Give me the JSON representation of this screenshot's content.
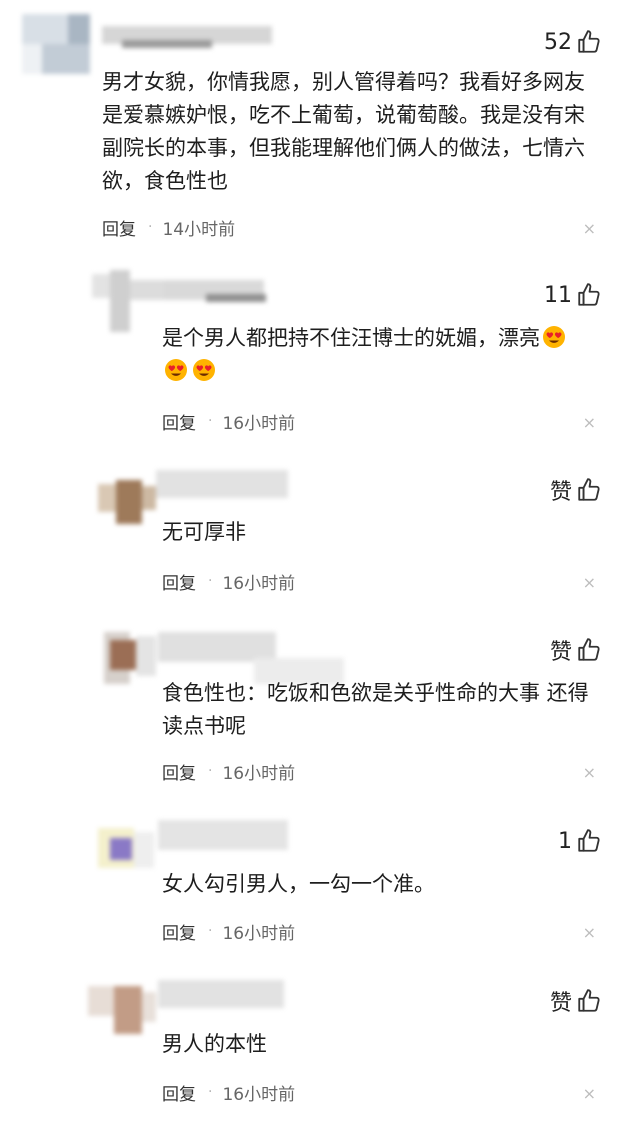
{
  "comments": [
    {
      "likes": "52",
      "text": "男才女貌，你情我愿，别人管得着吗？我看好多网友是爱慕嫉妒恨，吃不上葡萄，说葡萄酸。我是没有宋副院长的本事，但我能理解他们俩人的做法，七情六欲，食色性也",
      "reply_label": "回复",
      "dot": "·",
      "time": "14小时前",
      "close": "×"
    },
    {
      "likes": "11",
      "text": "是个男人都把持不住汪博士的妩媚，漂亮",
      "emojis": [
        "heart-eyes-emoji",
        "heart-eyes-emoji",
        "heart-eyes-emoji"
      ],
      "reply_label": "回复",
      "dot": "·",
      "time": "16小时前",
      "close": "×"
    },
    {
      "likes": "赞",
      "text": "无可厚非",
      "reply_label": "回复",
      "dot": "·",
      "time": "16小时前",
      "close": "×"
    },
    {
      "likes": "赞",
      "text": "食色性也：吃饭和色欲是关乎性命的大事 还得读点书呢",
      "reply_label": "回复",
      "dot": "·",
      "time": "16小时前",
      "close": "×"
    },
    {
      "likes": "1",
      "text": "女人勾引男人，一勾一个准。",
      "reply_label": "回复",
      "dot": "·",
      "time": "16小时前",
      "close": "×"
    },
    {
      "likes": "赞",
      "text": "男人的本性",
      "reply_label": "回复",
      "dot": "·",
      "time": "16小时前",
      "close": "×"
    }
  ],
  "colors": {
    "text": "#1e1e1e",
    "meta": "#666666",
    "close": "#bdbdbd",
    "emoji_face": "#ffb300",
    "emoji_heart": "#e8202a"
  },
  "icons": {
    "like": "thumbs-up-icon",
    "close": "close-icon",
    "emoji": "heart-eyes-emoji"
  }
}
